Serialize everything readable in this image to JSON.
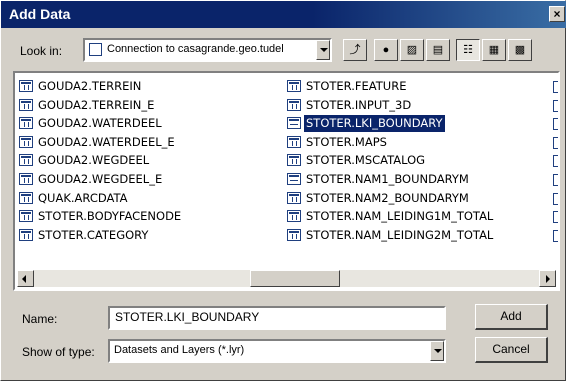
{
  "window": {
    "title": "Add Data",
    "close_glyph": "×"
  },
  "lookin": {
    "label": "Look in:",
    "value": "Connection to casagrande.geo.tudel",
    "icon": "database-connection-icon"
  },
  "toolbar": {
    "buttons": [
      {
        "name": "up-one-level-button",
        "glyph": "⤴"
      },
      {
        "name": "connect-folder-button",
        "glyph": "●"
      },
      {
        "name": "disconnect-folder-button",
        "glyph": "▨"
      },
      {
        "name": "properties-button",
        "glyph": "▤"
      },
      {
        "name": "list-view-button",
        "glyph": "☷"
      },
      {
        "name": "details-view-button",
        "glyph": "▦"
      },
      {
        "name": "thumbnails-view-button",
        "glyph": "▩"
      }
    ]
  },
  "list": {
    "items": [
      {
        "label": "GOUDA2.TERREIN",
        "type": "table"
      },
      {
        "label": "GOUDA2.TERREIN_E",
        "type": "table"
      },
      {
        "label": "GOUDA2.WATERDEEL",
        "type": "table"
      },
      {
        "label": "GOUDA2.WATERDEEL_E",
        "type": "table"
      },
      {
        "label": "GOUDA2.WEGDEEL",
        "type": "table"
      },
      {
        "label": "GOUDA2.WEGDEEL_E",
        "type": "table"
      },
      {
        "label": "QUAK.ARCDATA",
        "type": "table"
      },
      {
        "label": "STOTER.BODYFACENODE",
        "type": "table"
      },
      {
        "label": "STOTER.CATEGORY",
        "type": "table"
      },
      {
        "label": "STOTER.FEATURE",
        "type": "table"
      },
      {
        "label": "STOTER.INPUT_3D",
        "type": "table"
      },
      {
        "label": "STOTER.LKI_BOUNDARY",
        "type": "feature",
        "selected": true
      },
      {
        "label": "STOTER.MAPS",
        "type": "table"
      },
      {
        "label": "STOTER.MSCATALOG",
        "type": "table"
      },
      {
        "label": "STOTER.NAM1_BOUNDARYM",
        "type": "feature"
      },
      {
        "label": "STOTER.NAM2_BOUNDARYM",
        "type": "table"
      },
      {
        "label": "STOTER.NAM_LEIDING1M_TOTAL",
        "type": "table"
      },
      {
        "label": "STOTER.NAM_LEIDING2M_TOTAL",
        "type": "table"
      }
    ]
  },
  "name_field": {
    "label": "Name:",
    "value": "STOTER.LKI_BOUNDARY"
  },
  "type_field": {
    "label": "Show of type:",
    "value": "Datasets and Layers (*.lyr)"
  },
  "buttons": {
    "add": "Add",
    "cancel": "Cancel"
  },
  "colors": {
    "titlebar": "#0a246a",
    "selection": "#0a246a",
    "face": "#d4d0c8"
  }
}
